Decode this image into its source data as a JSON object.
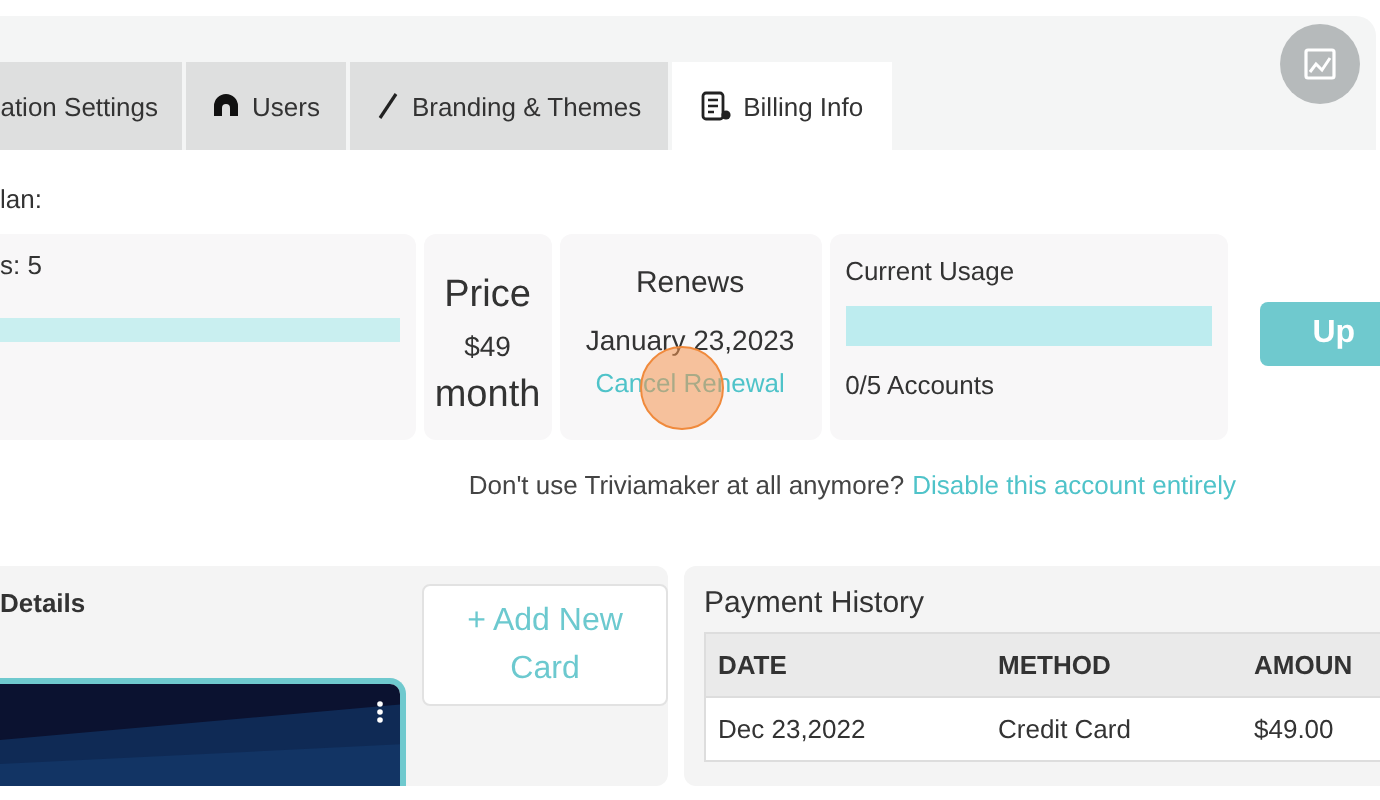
{
  "tabs": [
    {
      "label": "ation Settings",
      "selected": false
    },
    {
      "label": "Users",
      "selected": false
    },
    {
      "label": "Branding & Themes",
      "selected": false
    },
    {
      "label": "Billing Info",
      "selected": true
    }
  ],
  "plan_label": "lan:",
  "plan_card": {
    "text": "s: 5"
  },
  "price": {
    "title": "Price",
    "amount": "$49",
    "period": "month"
  },
  "renews": {
    "title": "Renews",
    "date": "January 23,2023",
    "link": "Cancel Renewal"
  },
  "usage": {
    "title": "Current Usage",
    "count": "0/5 Accounts"
  },
  "upgrade_button": "Up",
  "disable": {
    "text": "Don't use Triviamaker at all anymore?",
    "link": "Disable this account entirely"
  },
  "card_details": {
    "title": "Details",
    "add_button": "+ Add New Card"
  },
  "payment_history": {
    "title": "Payment History",
    "columns": [
      "DATE",
      "METHOD",
      "AMOUN"
    ],
    "rows": [
      [
        "Dec 23,2022",
        "Credit Card",
        "$49.00"
      ]
    ]
  }
}
